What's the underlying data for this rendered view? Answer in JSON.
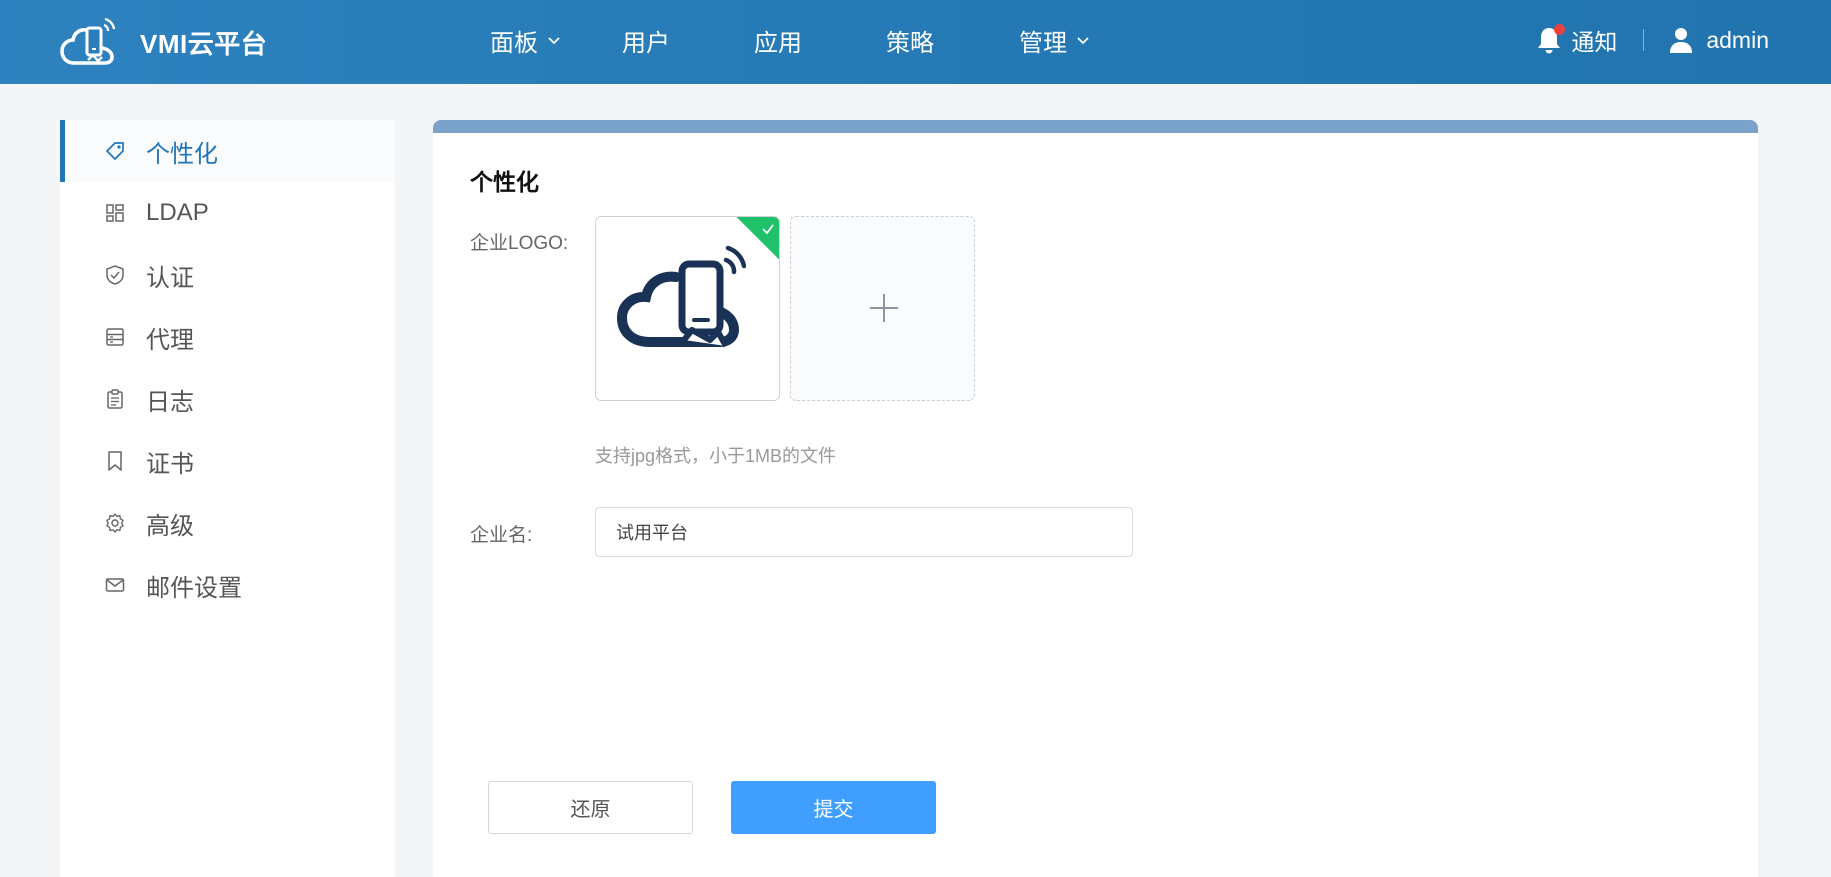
{
  "header": {
    "app_name": "VMI云平台",
    "nav": [
      {
        "label": "面板",
        "has_dropdown": true
      },
      {
        "label": "用户",
        "has_dropdown": false
      },
      {
        "label": "应用",
        "has_dropdown": false
      },
      {
        "label": "策略",
        "has_dropdown": false
      },
      {
        "label": "管理",
        "has_dropdown": true
      }
    ],
    "notify_label": "通知",
    "username": "admin"
  },
  "sidebar": {
    "items": [
      {
        "label": "个性化",
        "icon": "tag-icon",
        "active": true
      },
      {
        "label": "LDAP",
        "icon": "grid-icon",
        "active": false
      },
      {
        "label": "认证",
        "icon": "shield-check-icon",
        "active": false
      },
      {
        "label": "代理",
        "icon": "server-icon",
        "active": false
      },
      {
        "label": "日志",
        "icon": "clipboard-icon",
        "active": false
      },
      {
        "label": "证书",
        "icon": "bookmark-icon",
        "active": false
      },
      {
        "label": "高级",
        "icon": "gear-icon",
        "active": false
      },
      {
        "label": "邮件设置",
        "icon": "mail-icon",
        "active": false
      }
    ]
  },
  "main": {
    "title": "个性化",
    "logo_label": "企业LOGO:",
    "upload_hint": "支持jpg格式，小于1MB的文件",
    "name_label": "企业名:",
    "name_value": "试用平台",
    "reset_label": "还原",
    "submit_label": "提交"
  },
  "colors": {
    "header_bg": "#2479b4",
    "accent": "#2376b6",
    "submit_bg": "#409eff",
    "success_badge": "#1fc26b",
    "logo_navy": "#1b3257"
  }
}
